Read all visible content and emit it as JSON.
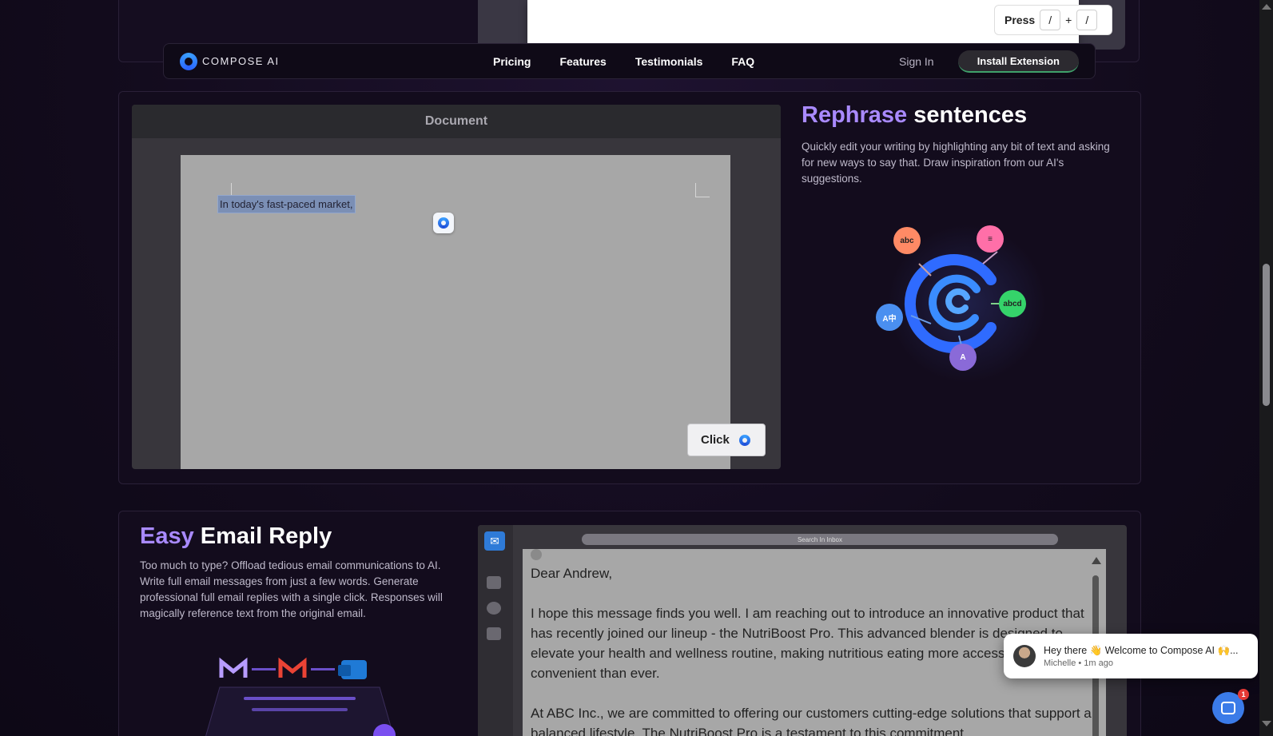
{
  "top_demo": {
    "press_label": "Press",
    "key1": "/",
    "plus": "+",
    "key2": "/"
  },
  "nav": {
    "logo_text": "COMPOSE AI",
    "links": [
      "Pricing",
      "Features",
      "Testimonials",
      "FAQ"
    ],
    "sign_in": "Sign In",
    "install": "Install Extension"
  },
  "rephrase": {
    "doc_title": "Document",
    "selected_text": "In today's fast-paced market,",
    "click_label": "Click",
    "title_accent": "Rephrase",
    "title_rest": " sentences",
    "description": "Quickly edit your writing by highlighting any bit of text and asking for new ways to say that. Draw inspiration from our AI's suggestions.",
    "bubbles": [
      "abc",
      "abcd"
    ]
  },
  "email": {
    "title_accent": "Easy",
    "title_rest": " Email Reply",
    "description": "Too much to type? Offload tedious email communications to AI. Write full email messages from just a few words. Generate professional full email replies with a single click. Responses will magically reference text from the original email.",
    "search_placeholder": "Search In Inbox",
    "body": [
      "Dear Andrew,",
      "I hope this message finds you well. I am reaching out to introduce an innovative product that has recently joined our lineup - the NutriBoost Pro. This advanced blender is designed to elevate your health and wellness routine, making nutritious eating more accessible and convenient than ever.",
      "At ABC Inc., we are committed to offering our customers cutting-edge solutions that support a balanced lifestyle. The NutriBoost Pro is a testament to this commitment"
    ]
  },
  "chat": {
    "message": "Hey there 👋 Welcome to Compose AI 🙌...",
    "meta": "Michelle • 1m ago",
    "badge": "1"
  },
  "colors": {
    "accent": "#a98aff",
    "brand_blue": "#2f6bff",
    "bg": "#120b1c"
  }
}
